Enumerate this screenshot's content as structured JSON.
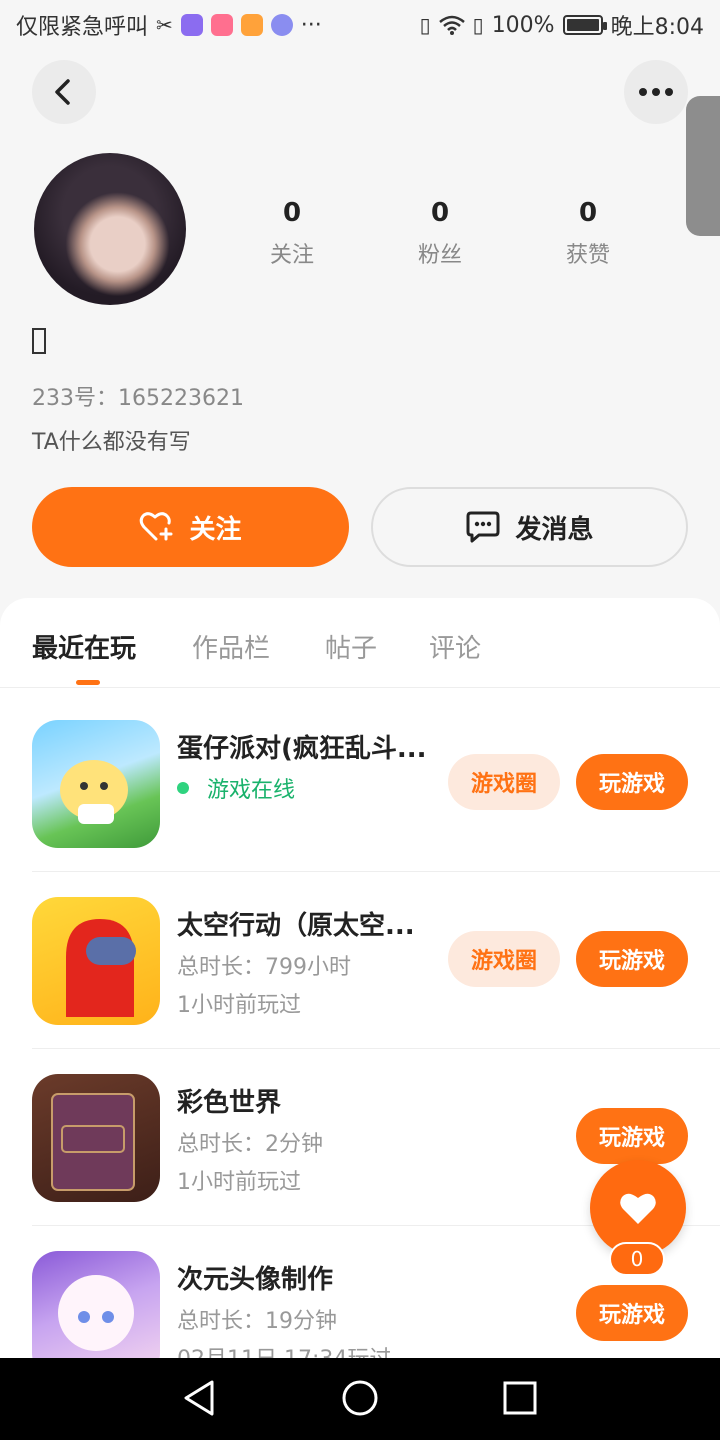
{
  "status_bar": {
    "carrier": "仅限紧急呼叫",
    "overflow": "···",
    "battery": "100%",
    "time": "晚上8:04",
    "icons": [
      "scissors-icon",
      "app-icon",
      "app-icon",
      "video-icon",
      "music-icon",
      "vibrate-icon",
      "wifi-icon",
      "sim-alert-icon",
      "battery-icon"
    ]
  },
  "nav": {
    "back_icon": "chevron-left-icon",
    "more_icon": "more-dots-icon"
  },
  "profile": {
    "stats": [
      {
        "value": "0",
        "label": "关注"
      },
      {
        "value": "0",
        "label": "粉丝"
      },
      {
        "value": "0",
        "label": "获赞"
      }
    ],
    "uid_label": "233号：",
    "uid": "165223621",
    "bio": "TA什么都没有写"
  },
  "actions": {
    "follow_label": "关注",
    "message_label": "发消息"
  },
  "tabs": [
    {
      "label": "最近在玩",
      "active": true
    },
    {
      "label": "作品栏",
      "active": false
    },
    {
      "label": "帖子",
      "active": false
    },
    {
      "label": "评论",
      "active": false
    }
  ],
  "games": [
    {
      "title": "蛋仔派对(疯狂乱斗...",
      "status": "游戏在线",
      "circle_label": "游戏圈",
      "play_label": "玩游戏"
    },
    {
      "title": "太空行动（原太空...",
      "duration": "总时长：799小时",
      "last_played": "1小时前玩过",
      "circle_label": "游戏圈",
      "play_label": "玩游戏"
    },
    {
      "title": "彩色世界",
      "duration": "总时长：2分钟",
      "last_played": "1小时前玩过",
      "play_label": "玩游戏"
    },
    {
      "title": "次元头像制作",
      "duration": "总时长：19分钟",
      "last_played": "02月11日 17:34玩过",
      "play_label": "玩游戏"
    }
  ],
  "like": {
    "count": "0"
  },
  "colors": {
    "accent": "#ff7214",
    "online": "#19b26b",
    "tag_bg": "#fde9dd"
  }
}
